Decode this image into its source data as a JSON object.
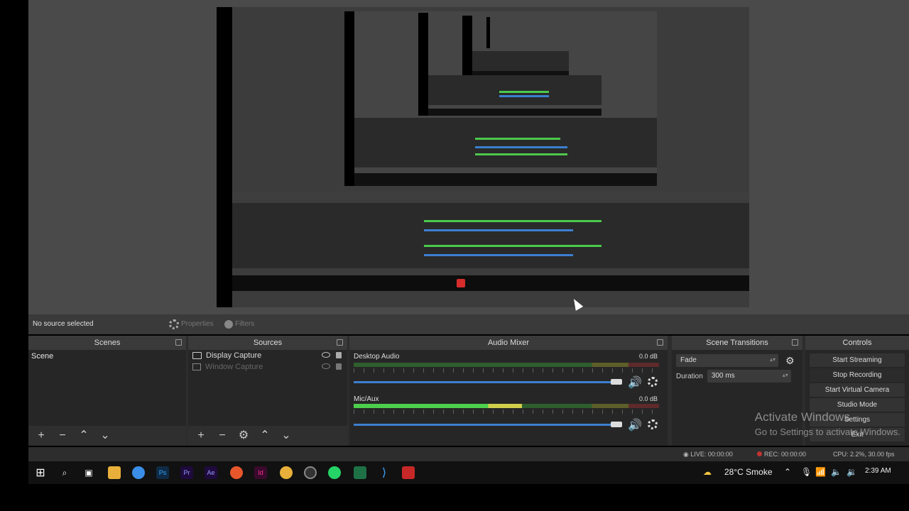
{
  "toolbar": {
    "no_source": "No source selected",
    "properties": "Properties",
    "filters": "Filters"
  },
  "docks": {
    "scenes": {
      "title": "Scenes",
      "items": [
        "Scene"
      ]
    },
    "sources": {
      "title": "Sources",
      "items": [
        "Display Capture",
        "Window Capture"
      ]
    },
    "mixer": {
      "title": "Audio Mixer",
      "channels": [
        {
          "name": "Desktop Audio",
          "db": "0.0 dB",
          "level_pct": 0
        },
        {
          "name": "Mic/Aux",
          "db": "0.0 dB",
          "level_pct": 55
        }
      ]
    },
    "transitions": {
      "title": "Scene Transitions",
      "selected": "Fade",
      "duration_label": "Duration",
      "duration_value": "300 ms"
    },
    "controls": {
      "title": "Controls",
      "buttons": [
        "Start Streaming",
        "Stop Recording",
        "Start Virtual Camera",
        "Studio Mode",
        "Settings",
        "Exit"
      ]
    }
  },
  "watermark": {
    "line1": "Activate Windows",
    "line2": "Go to Settings to activate Windows."
  },
  "status": {
    "live": "LIVE: 00:00:00",
    "rec": "REC: 00:00:00",
    "cpu": "CPU: 2.2%, 30.00 fps"
  },
  "taskbar": {
    "weather": "28°C  Smoke",
    "time": "2:39 AM"
  },
  "colors": {
    "accent_blue": "#3d7fd0",
    "meter_green": "#4ccf4c",
    "rec_red": "#c23232"
  }
}
